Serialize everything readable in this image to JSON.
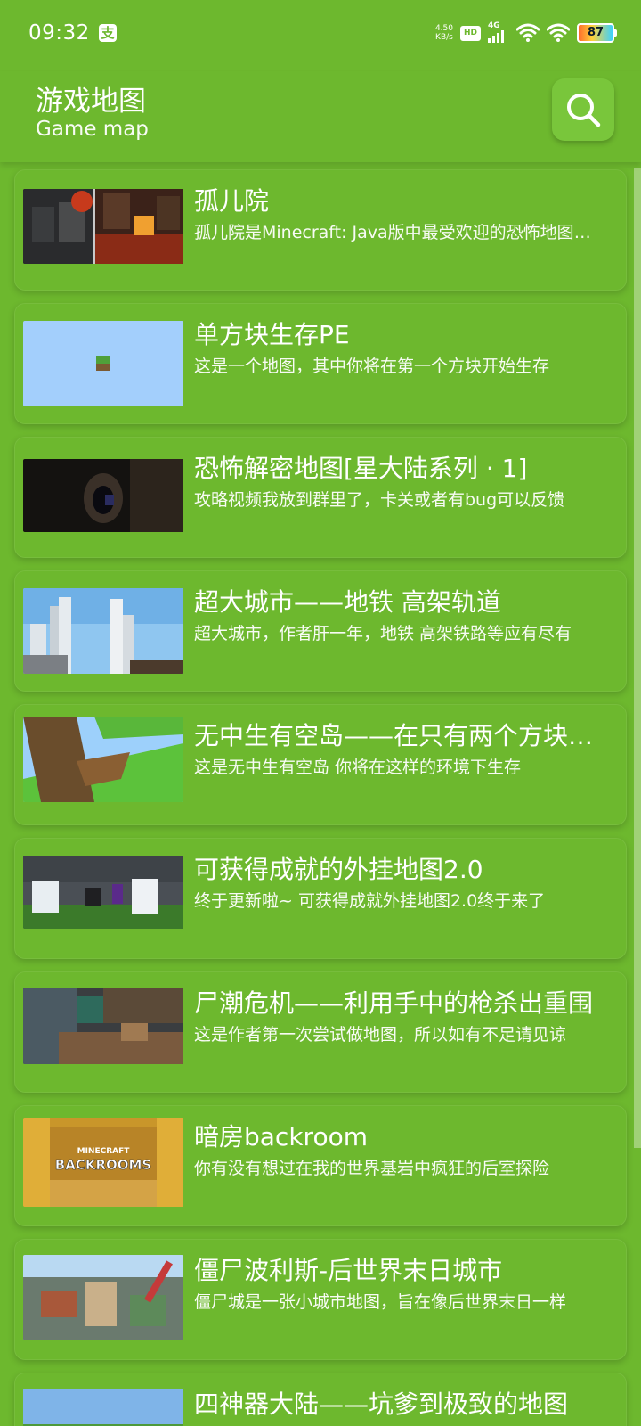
{
  "status_bar": {
    "time": "09:32",
    "notification_icon": "alipay-icon",
    "notification_glyph": "支",
    "net_speed_value": "4.50",
    "net_speed_unit": "KB/s",
    "hd_label": "HD",
    "network_type": "4G",
    "battery_level": "87"
  },
  "header": {
    "title": "游戏地图",
    "subtitle": "Game map",
    "search_icon": "search-icon"
  },
  "colors": {
    "background": "#6db82e",
    "accent": "#79c63b",
    "text": "#ffffff"
  },
  "maps": [
    {
      "title": "孤儿院",
      "description": "孤儿院是Minecraft: Java版中最受欢迎的恐怖地图之一"
    },
    {
      "title": "单方块生存PE",
      "description": "这是一个地图，其中你将在第一个方块开始生存"
    },
    {
      "title": "恐怖解密地图[星大陆系列 · 1]",
      "description": "攻略视频我放到群里了，卡关或者有bug可以反馈"
    },
    {
      "title": "超大城市——地铁 高架轨道",
      "description": "超大城市，作者肝一年，地铁 高架铁路等应有尽有"
    },
    {
      "title": "无中生有空岛——在只有两个方块的世界",
      "description": "这是无中生有空岛 你将在这样的环境下生存"
    },
    {
      "title": "可获得成就的外挂地图2.0",
      "description": "终于更新啦~  可获得成就外挂地图2.0终于来了"
    },
    {
      "title": "尸潮危机——利用手中的枪杀出重围",
      "description": "这是作者第一次尝试做地图，所以如有不足请见谅"
    },
    {
      "title": "暗房backroom",
      "description": "你有没有想过在我的世界基岩中疯狂的后室探险",
      "thumb_text": "MINECRAFT",
      "thumb_text2": "BACKROOMS"
    },
    {
      "title": "僵尸波利斯-后世界末日城市",
      "description": "僵尸城是一张小城市地图，旨在像后世界末日一样"
    },
    {
      "title": "四神器大陆——坑爹到极致的地图",
      "description": ""
    }
  ]
}
